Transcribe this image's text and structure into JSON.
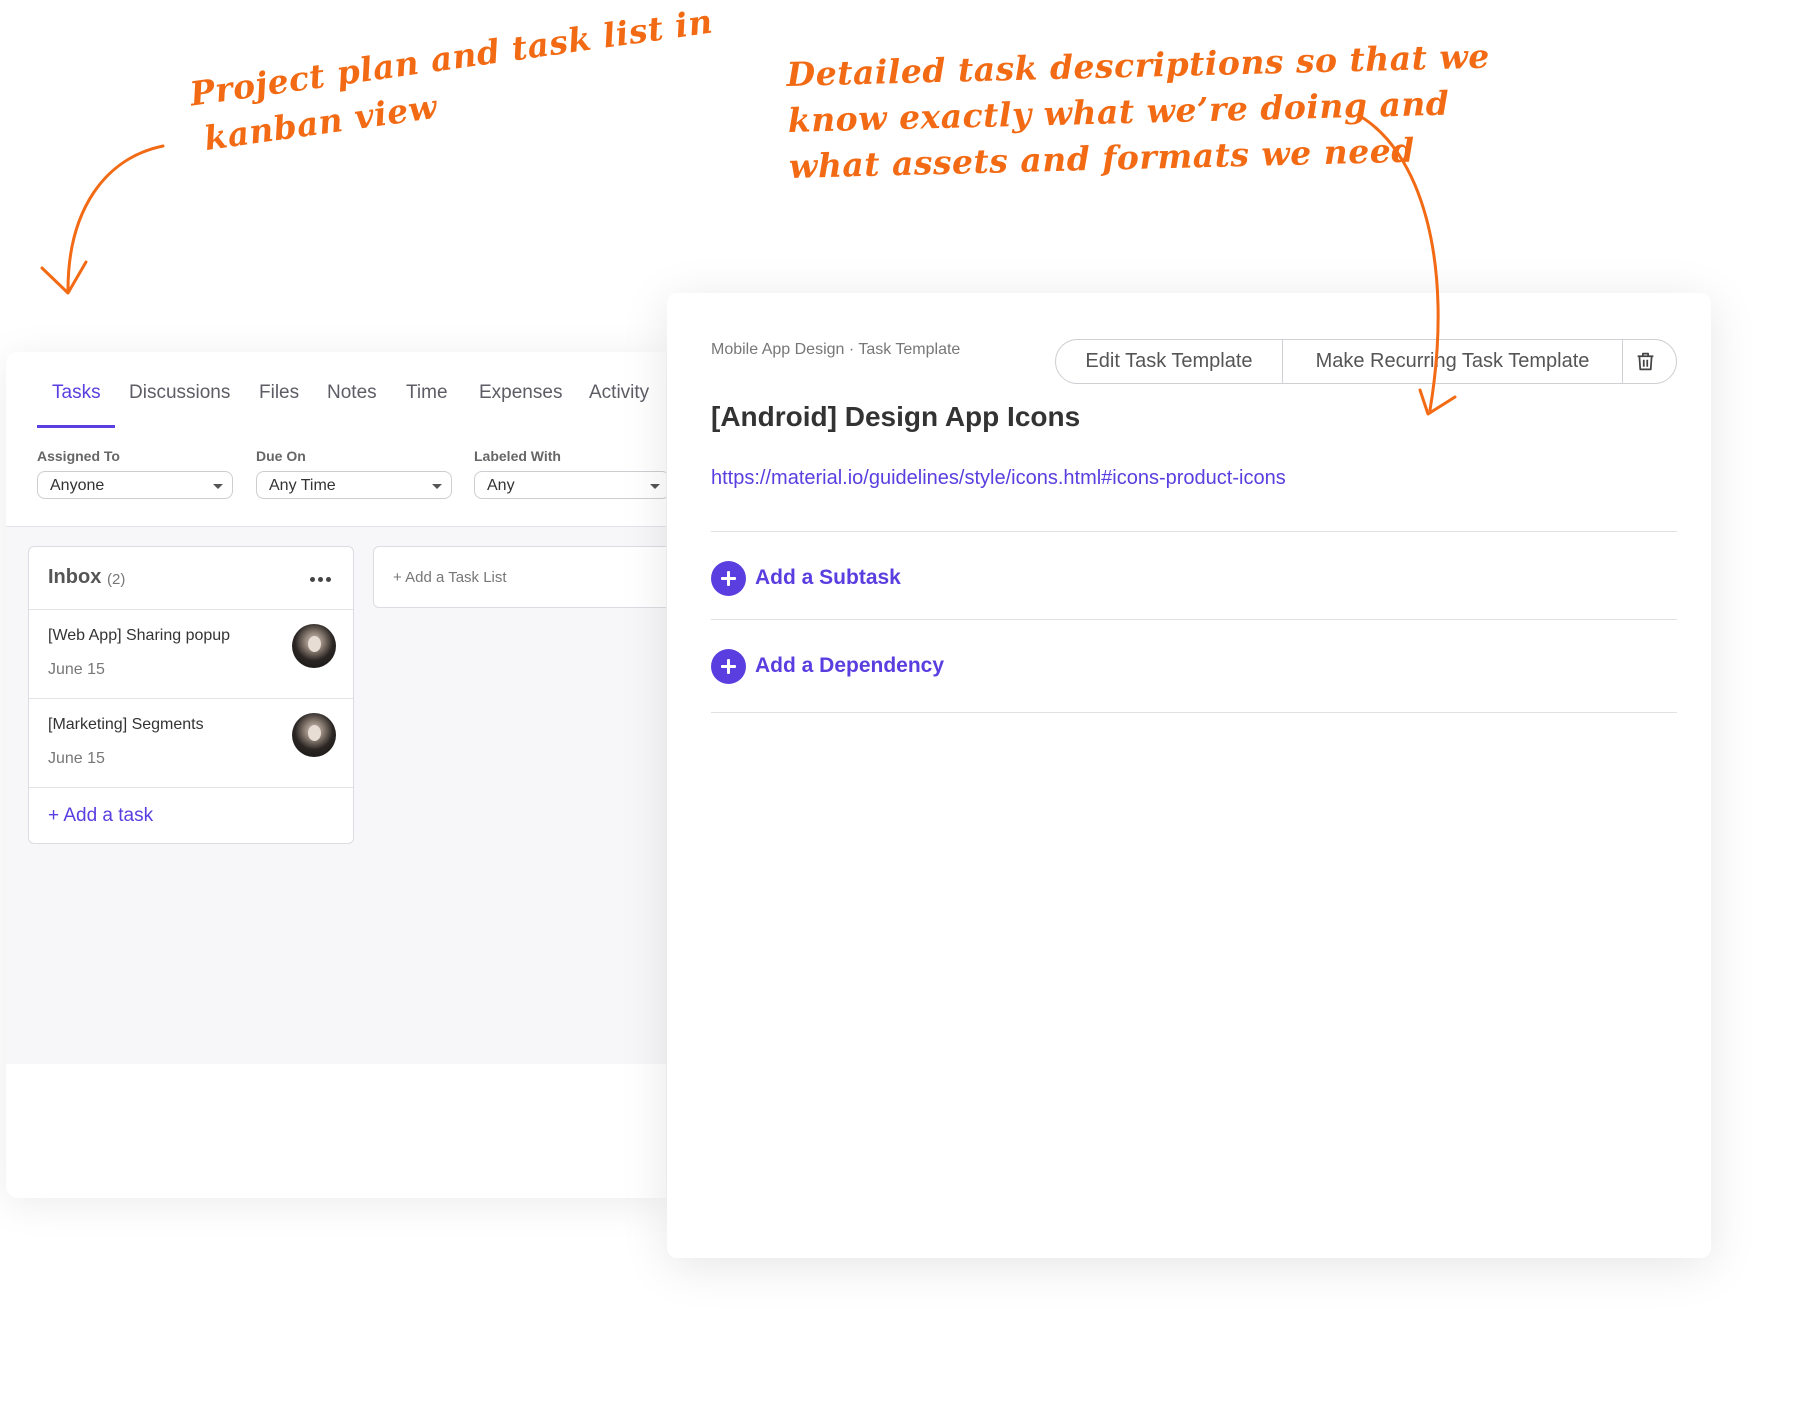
{
  "annotations": {
    "left": [
      "Project plan and task list in",
      "kanban view"
    ],
    "right": [
      "Detailed task descriptions so that we",
      "know exactly what we’re doing and",
      "what assets and formats we need"
    ],
    "color": "#f26a13"
  },
  "project_view": {
    "tabs": [
      "Tasks",
      "Discussions",
      "Files",
      "Notes",
      "Time",
      "Expenses",
      "Activity"
    ],
    "active_tab": "Tasks",
    "filters": [
      {
        "label": "Assigned To",
        "value": "Anyone"
      },
      {
        "label": "Due On",
        "value": "Any Time"
      },
      {
        "label": "Labeled With",
        "value": "Any"
      }
    ],
    "inbox": {
      "title": "Inbox",
      "count": "(2)",
      "tasks": [
        {
          "title": "[Web App] Sharing popup",
          "date": "June 15"
        },
        {
          "title": "[Marketing] Segments",
          "date": "June 15"
        }
      ],
      "add_task": "+ Add a task"
    },
    "add_task_list": "+ Add a Task List"
  },
  "task_detail": {
    "breadcrumb": "Mobile App Design · Task Template",
    "buttons": {
      "edit": "Edit Task Template",
      "recurring": "Make Recurring Task Template"
    },
    "title": "[Android] Design App Icons",
    "link": "https://material.io/guidelines/style/icons.html#icons-product-icons",
    "add_subtask": "Add a Subtask",
    "add_dependency": "Add a Dependency"
  },
  "colors": {
    "accent": "#5a3ee0",
    "annotation": "#f26a13"
  }
}
